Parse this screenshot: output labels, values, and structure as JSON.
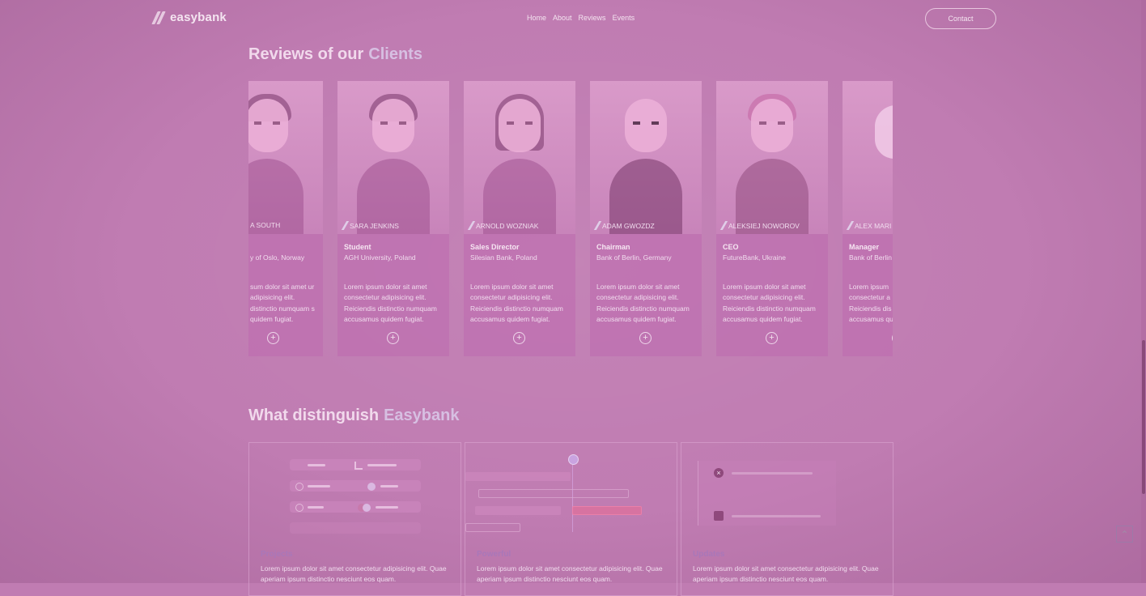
{
  "header": {
    "logo_text": "easybank",
    "nav": [
      "Home",
      "About",
      "Reviews",
      "Events"
    ],
    "contact_label": "Contact"
  },
  "reviews": {
    "title": "Reviews of our",
    "title_highlight": "Clients",
    "cards": [
      {
        "name": "A SOUTH",
        "role": "",
        "org": "y of Oslo, Norway",
        "text": "sum dolor sit amet ur adipisicing elit. distinctio numquam s quidem fugiat."
      },
      {
        "name": "SARA JENKINS",
        "role": "Student",
        "org": "AGH University, Poland",
        "text": "Lorem ipsum dolor sit amet consectetur adipisicing elit. Reiciendis distinctio numquam accusamus quidem fugiat."
      },
      {
        "name": "ARNOLD WOZNIAK",
        "role": "Sales Director",
        "org": "Silesian Bank, Poland",
        "text": "Lorem ipsum dolor sit amet consectetur adipisicing elit. Reiciendis distinctio numquam accusamus quidem fugiat."
      },
      {
        "name": "ADAM GWOZDZ",
        "role": "Chairman",
        "org": "Bank of Berlin, Germany",
        "text": "Lorem ipsum dolor sit amet consectetur adipisicing elit. Reiciendis distinctio numquam accusamus quidem fugiat."
      },
      {
        "name": "ALEKSIEJ NOWOROV",
        "role": "CEO",
        "org": "FutureBank, Ukraine",
        "text": "Lorem ipsum dolor sit amet consectetur adipisicing elit. Reiciendis distinctio numquam accusamus quidem fugiat."
      },
      {
        "name": "ALEX MARI",
        "role": "Manager",
        "org": "Bank of Berlin",
        "text": "Lorem ipsum consectetur a Reiciendis dis accusamus qu"
      }
    ],
    "plus_label": "+"
  },
  "features": {
    "title": "What distinguish",
    "title_highlight": "Easybank",
    "items": [
      {
        "title": "Projects",
        "text": "Lorem ipsum dolor sit amet consectetur adipisicing elit. Quae aperiam ipsum distinctio nesciunt eos quam."
      },
      {
        "title": "Powerful",
        "text": "Lorem ipsum dolor sit amet consectetur adipisicing elit. Quae aperiam ipsum distinctio nesciunt eos quam."
      },
      {
        "title": "Updates",
        "text": "Lorem ipsum dolor sit amet consectetur adipisicing elit. Quae aperiam ipsum distinctio nesciunt eos quam."
      }
    ]
  },
  "icons": {
    "scroll_top": "chevron-up-icon",
    "plus": "plus-icon",
    "close": "close-icon",
    "check": "check-icon",
    "bar_chart": "bar-chart-icon",
    "archive": "archive-icon"
  },
  "colors": {
    "background": "#c07cb2",
    "highlight": "#d7bfe2",
    "accent": "#a977b9"
  }
}
